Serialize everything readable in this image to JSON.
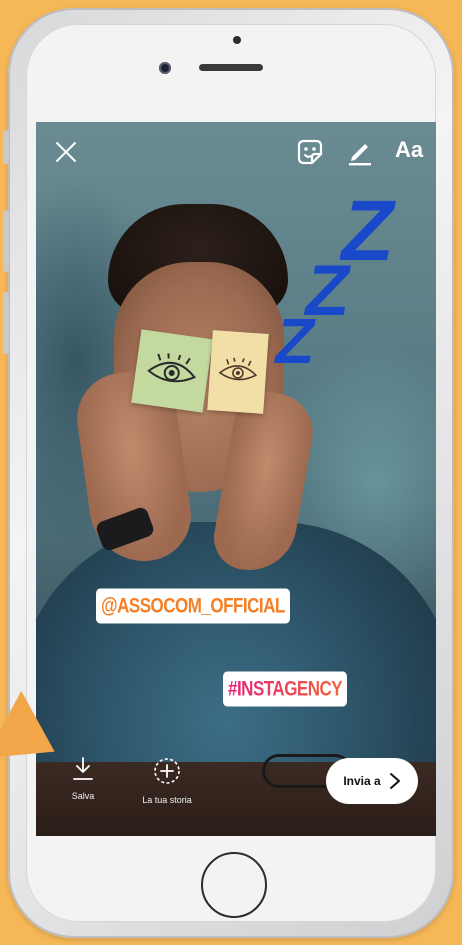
{
  "colors": {
    "page_background": "#f6b757",
    "pointer_arrow": "#f1a64a",
    "zzz_blue": "#1948c8",
    "mention_orange": "#f57f25",
    "hashtag_gradient_start": "#e3257b",
    "hashtag_gradient_end": "#f0653b"
  },
  "top_bar": {
    "close_icon": "close-icon",
    "sticker_icon": "sticker-icon",
    "draw_icon": "pen-icon",
    "text_label": "Aa"
  },
  "stickers": {
    "zzz": [
      "Z",
      "Z",
      "Z"
    ],
    "mention": "@ASSOCOM_OFFICIAL",
    "hashtag": "#INSTAGENCY"
  },
  "bottom_bar": {
    "save_label": "Salva",
    "story_label": "La tua storia",
    "send_label": "Invia a"
  }
}
